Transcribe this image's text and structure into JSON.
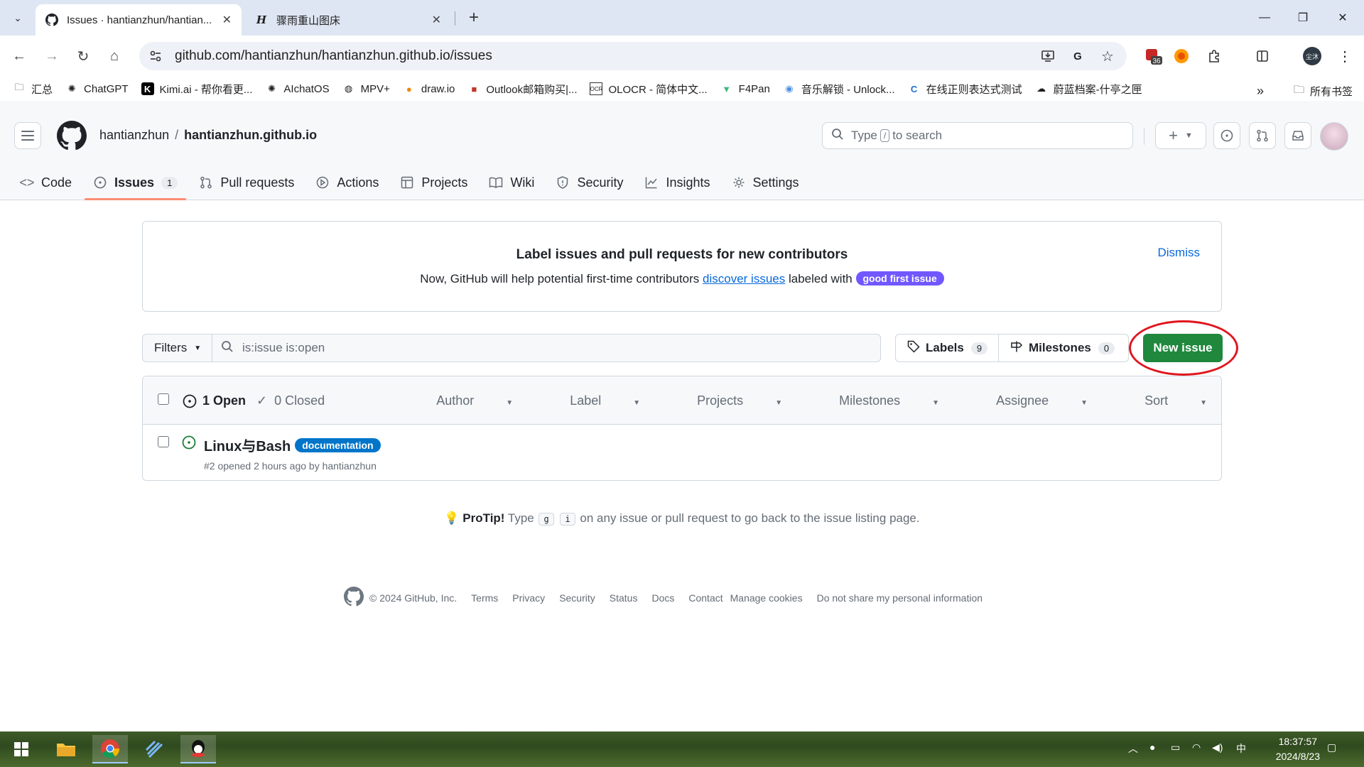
{
  "browser": {
    "tabs": [
      {
        "title": "Issues · hantianzhun/hantian...",
        "active": true
      },
      {
        "title": "骤雨重山图床",
        "active": false
      }
    ],
    "url": "github.com/hantianzhun/hantianzhun.github.io/issues",
    "extension_badge": "36",
    "profile_label": "尘沐"
  },
  "bookmarks": {
    "items": [
      "汇总",
      "ChatGPT",
      "Kimi.ai - 帮你看更...",
      "AIchatOS",
      "MPV+",
      "draw.io",
      "Outlook邮箱购买|...",
      "OLOCR - 简体中文...",
      "F4Pan",
      "音乐解锁 - Unlock...",
      "在线正则表达式测试",
      "蔚蓝档案-什亭之匣"
    ],
    "overflow": "»",
    "all_bookmarks": "所有书签"
  },
  "repo": {
    "owner": "hantianzhun",
    "separator": "/",
    "name": "hantianzhun.github.io"
  },
  "search": {
    "prefix": "Type",
    "key": "/",
    "suffix": "to search"
  },
  "repo_nav": [
    {
      "label": "Code",
      "icon": "code-icon"
    },
    {
      "label": "Issues",
      "icon": "issue-icon",
      "count": "1",
      "active": true
    },
    {
      "label": "Pull requests",
      "icon": "pull-request-icon"
    },
    {
      "label": "Actions",
      "icon": "actions-icon"
    },
    {
      "label": "Projects",
      "icon": "projects-icon"
    },
    {
      "label": "Wiki",
      "icon": "wiki-icon"
    },
    {
      "label": "Security",
      "icon": "shield-icon"
    },
    {
      "label": "Insights",
      "icon": "graph-icon"
    },
    {
      "label": "Settings",
      "icon": "gear-icon"
    }
  ],
  "banner": {
    "title": "Label issues and pull requests for new contributors",
    "text_before": "Now, GitHub will help potential first-time contributors",
    "link": "discover issues",
    "text_after": "labeled with",
    "badge": "good first issue",
    "dismiss": "Dismiss"
  },
  "filters": {
    "button": "Filters",
    "query": "is:issue is:open",
    "labels": "Labels",
    "labels_count": "9",
    "milestones": "Milestones",
    "milestones_count": "0",
    "new_issue": "New issue"
  },
  "issue_list": {
    "open": "1 Open",
    "closed": "0 Closed",
    "sort_menus": [
      "Author",
      "Label",
      "Projects",
      "Milestones",
      "Assignee",
      "Sort"
    ],
    "issues": [
      {
        "title": "Linux与Bash",
        "label": "documentation",
        "meta": "#2 opened 2 hours ago by hantianzhun"
      }
    ]
  },
  "protip": {
    "lead": "ProTip!",
    "type": "Type",
    "key1": "g",
    "key2": "i",
    "rest": "on any issue or pull request to go back to the issue listing page."
  },
  "footer": {
    "copyright": "© 2024 GitHub, Inc.",
    "links": [
      "Terms",
      "Privacy",
      "Security",
      "Status",
      "Docs",
      "Contact",
      "Manage cookies",
      "Do not share my personal information"
    ]
  },
  "taskbar": {
    "time": "18:37:57",
    "date": "2024/8/23",
    "ime": "中"
  },
  "colors": {
    "accent_green": "#1f883d",
    "link_blue": "#0969da",
    "good_first_issue": "#7057ff",
    "documentation": "#0075ca",
    "highlight_red": "#e0161f"
  }
}
